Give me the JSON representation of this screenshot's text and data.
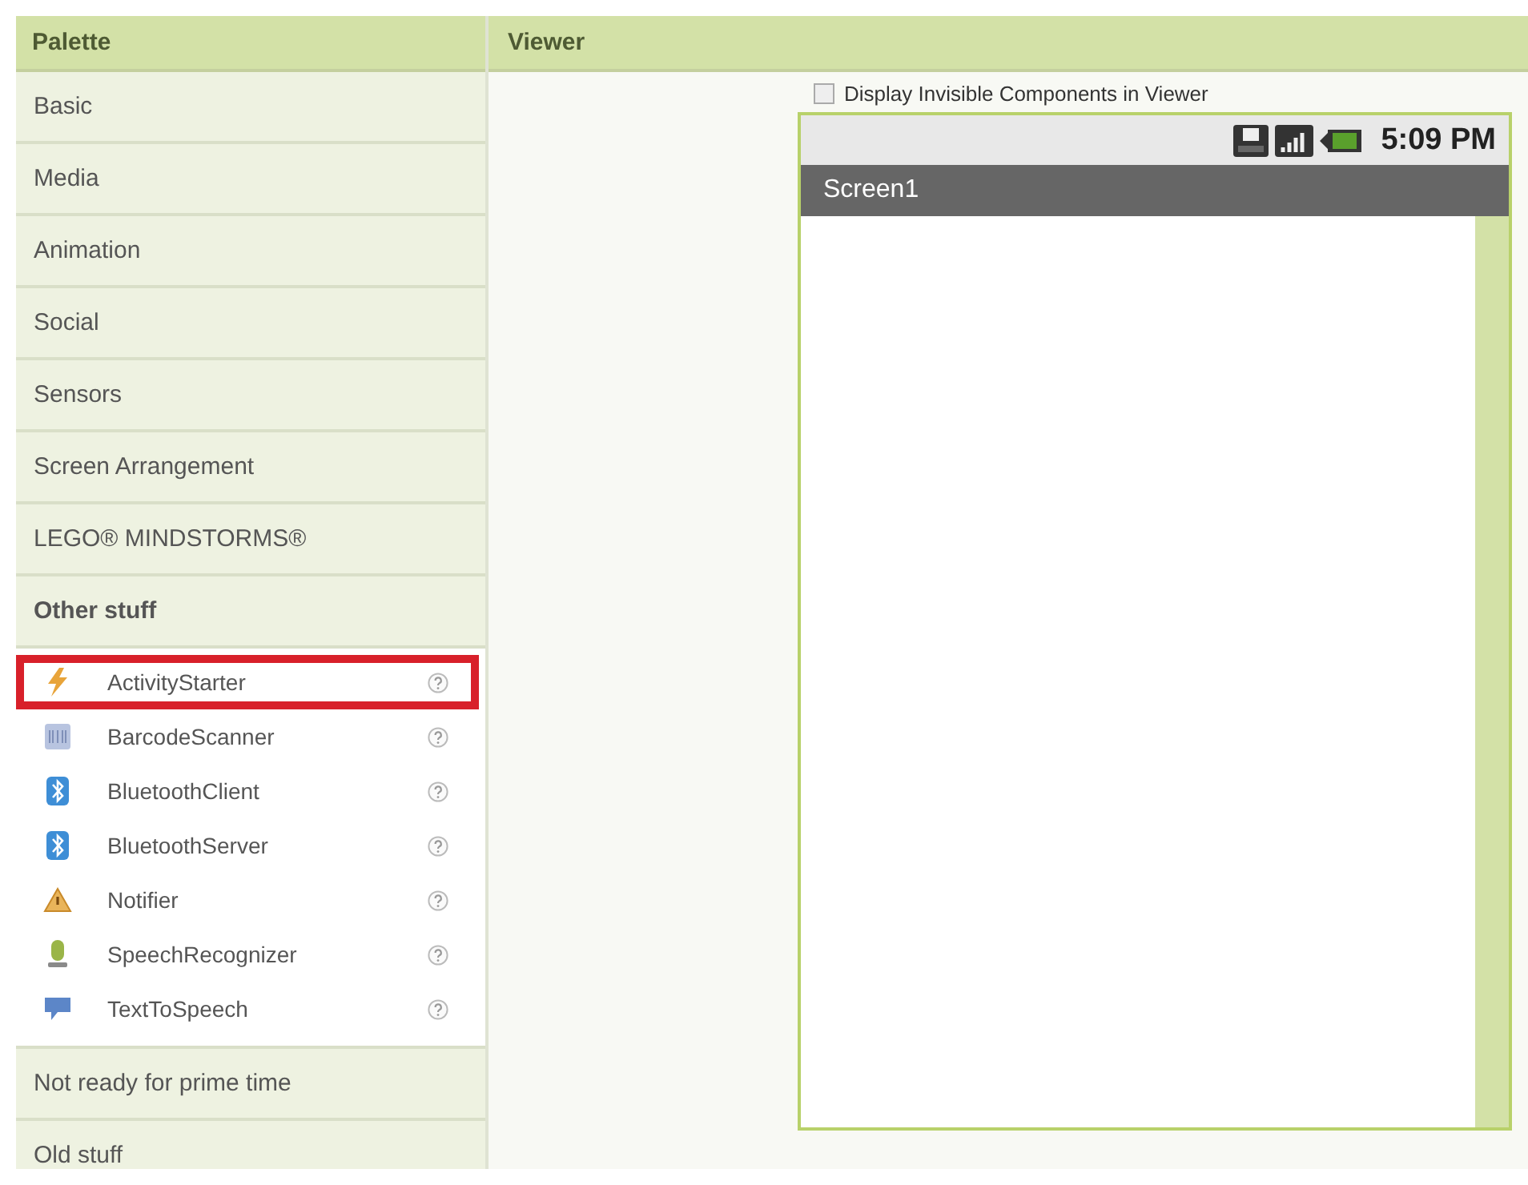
{
  "palette": {
    "title": "Palette",
    "categories": [
      {
        "label": "Basic",
        "expanded": false
      },
      {
        "label": "Media",
        "expanded": false
      },
      {
        "label": "Animation",
        "expanded": false
      },
      {
        "label": "Social",
        "expanded": false
      },
      {
        "label": "Sensors",
        "expanded": false
      },
      {
        "label": "Screen Arrangement",
        "expanded": false
      },
      {
        "label": "LEGO® MINDSTORMS®",
        "expanded": false
      },
      {
        "label": "Other stuff",
        "expanded": true,
        "children": [
          {
            "label": "ActivityStarter",
            "kind": "activity",
            "highlighted": true
          },
          {
            "label": "BarcodeScanner",
            "kind": "barcode",
            "highlighted": false
          },
          {
            "label": "BluetoothClient",
            "kind": "bluetooth",
            "highlighted": false
          },
          {
            "label": "BluetoothServer",
            "kind": "bluetooth",
            "highlighted": false
          },
          {
            "label": "Notifier",
            "kind": "notifier",
            "highlighted": false
          },
          {
            "label": "SpeechRecognizer",
            "kind": "speech",
            "highlighted": false
          },
          {
            "label": "TextToSpeech",
            "kind": "tts",
            "highlighted": false
          }
        ]
      },
      {
        "label": "Not ready for prime time",
        "expanded": false
      },
      {
        "label": "Old stuff",
        "expanded": false
      }
    ]
  },
  "viewer": {
    "title": "Viewer",
    "display_invisible": {
      "label": "Display Invisible Components in Viewer",
      "checked": false
    },
    "phone": {
      "time": "5:09 PM",
      "screen_title": "Screen1"
    }
  }
}
